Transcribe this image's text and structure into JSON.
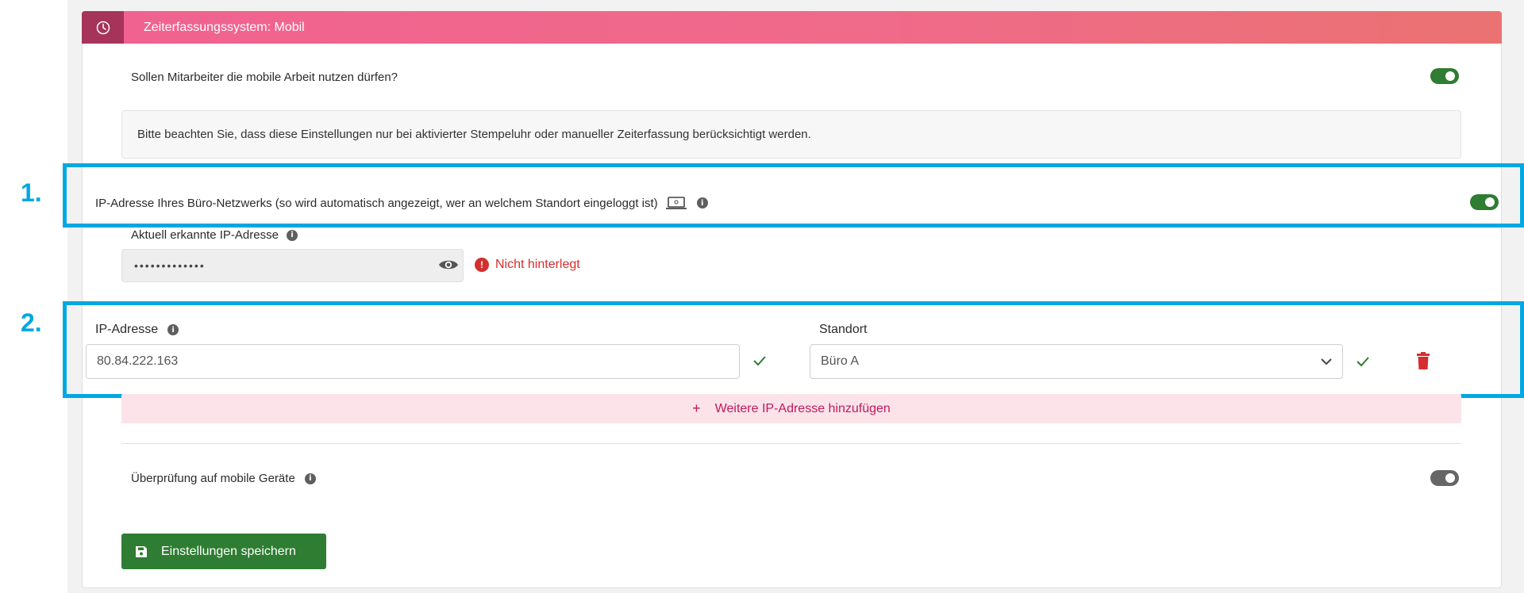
{
  "header": {
    "title": "Zeiterfassungssystem: Mobil",
    "icon": "clock-icon"
  },
  "mobile_work": {
    "question": "Sollen Mitarbeiter die mobile Arbeit nutzen dürfen?",
    "enabled": true
  },
  "notice": {
    "text": "Bitte beachten Sie, dass diese Einstellungen nur bei aktivierter Stempeluhr oder manueller Zeiterfassung berücksichtigt werden."
  },
  "ip_network": {
    "label": "IP-Adresse Ihres Büro-Netzwerks (so wird automatisch angezeigt, wer an welchem Standort eingeloggt ist)",
    "enabled": true
  },
  "detected_ip": {
    "label": "Aktuell erkannte IP-Adresse",
    "masked_value": "•••••••••••••",
    "status": "Nicht hinterlegt"
  },
  "ip_entry": {
    "ip_label": "IP-Adresse",
    "ip_value": "80.84.222.163",
    "location_label": "Standort",
    "location_value": "Büro A"
  },
  "add_ip": {
    "label": "Weitere IP-Adresse hinzufügen",
    "plus": "+"
  },
  "mobile_check": {
    "label": "Überprüfung auf mobile Geräte",
    "enabled": false
  },
  "save": {
    "label": "Einstellungen speichern"
  },
  "annotations": {
    "one": "1.",
    "two": "2."
  },
  "colors": {
    "accent_pink": "#f06290",
    "green": "#2e7d32",
    "highlight": "#00a8e1",
    "error": "#d32f2f"
  }
}
